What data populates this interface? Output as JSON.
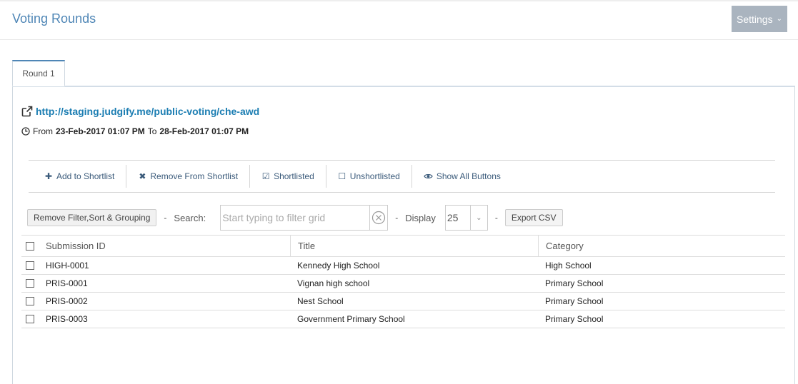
{
  "header": {
    "title": "Voting Rounds",
    "settings_label": "Settings"
  },
  "tabs": [
    {
      "label": "Round 1",
      "active": true
    }
  ],
  "round": {
    "public_url": "http://staging.judgify.me/public-voting/che-awd",
    "from_label": "From",
    "from_date": "23-Feb-2017 01:07 PM",
    "to_label": "To",
    "to_date": "28-Feb-2017 01:07 PM"
  },
  "toolbar": {
    "buttons": [
      {
        "label": "Add to Shortlist",
        "icon": "plus-icon"
      },
      {
        "label": "Remove From Shortlist",
        "icon": "x-icon"
      },
      {
        "label": "Shortlisted",
        "icon": "checked-box-icon"
      },
      {
        "label": "Unshortlisted",
        "icon": "empty-box-icon"
      },
      {
        "label": "Show All Buttons",
        "icon": "eye-icon"
      }
    ]
  },
  "filters": {
    "remove_label": "Remove Filter,Sort & Grouping",
    "search_label": "Search:",
    "search_placeholder": "Start typing to filter grid",
    "search_value": "",
    "display_label": "Display",
    "display_value": "25",
    "export_label": "Export CSV",
    "separator": "-"
  },
  "grid": {
    "columns": [
      "Submission ID",
      "Title",
      "Category"
    ],
    "rows": [
      {
        "id": "HIGH-0001",
        "title": "Kennedy High School",
        "category": "High School"
      },
      {
        "id": "PRIS-0001",
        "title": "Vignan high school",
        "category": "Primary School"
      },
      {
        "id": "PRIS-0002",
        "title": "Nest School",
        "category": "Primary School"
      },
      {
        "id": "PRIS-0003",
        "title": "Government Primary School",
        "category": "Primary School"
      }
    ]
  },
  "colors": {
    "accent": "#4f86b6",
    "link": "#1b7db2",
    "settings_bg": "#aab4bf"
  }
}
